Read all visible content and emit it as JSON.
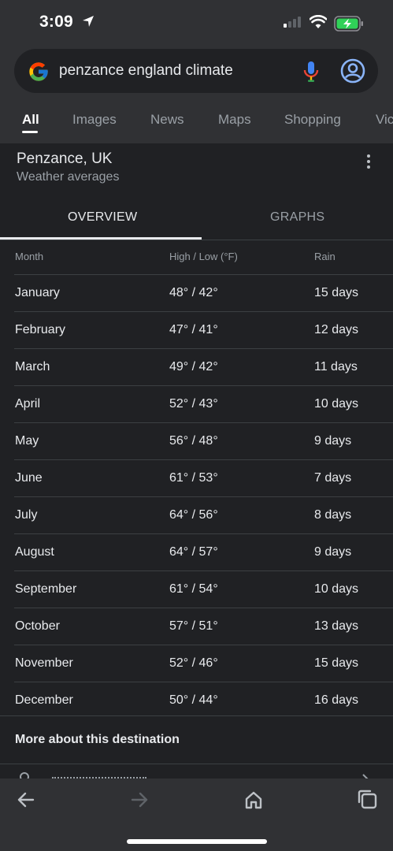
{
  "status": {
    "time": "3:09"
  },
  "search": {
    "query": "penzance england climate"
  },
  "tabs": [
    {
      "label": "All"
    },
    {
      "label": "Images"
    },
    {
      "label": "News"
    },
    {
      "label": "Maps"
    },
    {
      "label": "Shopping"
    },
    {
      "label": "Vic"
    }
  ],
  "weather": {
    "place": "Penzance, UK",
    "subtitle": "Weather averages",
    "tabs": {
      "overview": "OVERVIEW",
      "graphs": "GRAPHS"
    },
    "columns": {
      "month": "Month",
      "temp": "High / Low  (°F)",
      "rain": "Rain"
    },
    "rows": [
      {
        "month": "January",
        "temp": "48° / 42°",
        "rain": "15 days"
      },
      {
        "month": "February",
        "temp": "47° / 41°",
        "rain": "12 days"
      },
      {
        "month": "March",
        "temp": "49° / 42°",
        "rain": "11 days"
      },
      {
        "month": "April",
        "temp": "52° / 43°",
        "rain": "10 days"
      },
      {
        "month": "May",
        "temp": "56° / 48°",
        "rain": "9 days"
      },
      {
        "month": "June",
        "temp": "61° / 53°",
        "rain": "7 days"
      },
      {
        "month": "July",
        "temp": "64° / 56°",
        "rain": "8 days"
      },
      {
        "month": "August",
        "temp": "64° / 57°",
        "rain": "9 days"
      },
      {
        "month": "September",
        "temp": "61° / 54°",
        "rain": "10 days"
      },
      {
        "month": "October",
        "temp": "57° / 51°",
        "rain": "13 days"
      },
      {
        "month": "November",
        "temp": "52° / 46°",
        "rain": "15 days"
      },
      {
        "month": "December",
        "temp": "50° / 44°",
        "rain": "16 days"
      }
    ],
    "more_about": "More about this destination"
  },
  "colors": {
    "background": "#202124",
    "surface": "#303134",
    "text": "#e8eaed",
    "muted": "#9aa0a6"
  }
}
